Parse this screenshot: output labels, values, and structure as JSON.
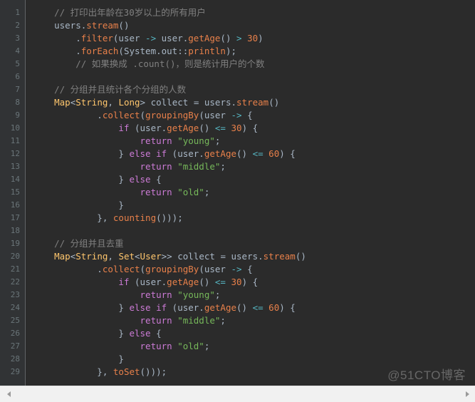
{
  "editor": {
    "theme_name": "darcula",
    "colors": {
      "editor_background": "#2b2b2b",
      "gutter_background": "#313335",
      "gutter_separator": "#606366",
      "line_number": "#6a7579",
      "default_text": "#a9b7c6",
      "comment": "#808080",
      "keyword": "#cc7bd6",
      "type": "#ffc66d",
      "method": "#e8804a",
      "string": "#76b85a",
      "number": "#e8804a",
      "operator": "#56b6c2",
      "chrome_background": "#f1f1f1",
      "scrollbar_thumb": "#cdcdcd"
    },
    "language": "java",
    "total_lines": 29,
    "line_numbers": [
      1,
      2,
      3,
      4,
      5,
      6,
      7,
      8,
      9,
      10,
      11,
      12,
      13,
      14,
      15,
      16,
      17,
      18,
      19,
      20,
      21,
      22,
      23,
      24,
      25,
      26,
      27,
      28,
      29
    ],
    "lines": [
      {
        "number": 1,
        "text": "    // 打印出年龄在30岁以上的所有用户",
        "tokens": [
          {
            "t": "    ",
            "c": "plain"
          },
          {
            "t": "// 打印出年龄在30岁以上的所有用户",
            "c": "comment"
          }
        ]
      },
      {
        "number": 2,
        "text": "    users.stream()",
        "tokens": [
          {
            "t": "    users",
            "c": "plain"
          },
          {
            "t": ".",
            "c": "punc"
          },
          {
            "t": "stream",
            "c": "method"
          },
          {
            "t": "()",
            "c": "punc"
          }
        ]
      },
      {
        "number": 3,
        "text": "        .filter(user -> user.getAge() > 30)",
        "tokens": [
          {
            "t": "        .",
            "c": "punc"
          },
          {
            "t": "filter",
            "c": "method"
          },
          {
            "t": "(user ",
            "c": "plain"
          },
          {
            "t": "->",
            "c": "operator"
          },
          {
            "t": " user.",
            "c": "plain"
          },
          {
            "t": "getAge",
            "c": "method"
          },
          {
            "t": "() ",
            "c": "punc"
          },
          {
            "t": ">",
            "c": "operator"
          },
          {
            "t": " ",
            "c": "plain"
          },
          {
            "t": "30",
            "c": "number"
          },
          {
            "t": ")",
            "c": "punc"
          }
        ]
      },
      {
        "number": 4,
        "text": "        .forEach(System.out::println);",
        "tokens": [
          {
            "t": "        .",
            "c": "punc"
          },
          {
            "t": "forEach",
            "c": "method"
          },
          {
            "t": "(System.out::",
            "c": "plain"
          },
          {
            "t": "println",
            "c": "method"
          },
          {
            "t": ");",
            "c": "punc"
          }
        ]
      },
      {
        "number": 5,
        "text": "        // 如果换成 .count()，则是统计用户的个数",
        "tokens": [
          {
            "t": "        ",
            "c": "plain"
          },
          {
            "t": "// 如果换成 .count()，则是统计用户的个数",
            "c": "comment"
          }
        ]
      },
      {
        "number": 6,
        "text": "",
        "tokens": []
      },
      {
        "number": 7,
        "text": "    // 分组并且统计各个分组的人数",
        "tokens": [
          {
            "t": "    ",
            "c": "plain"
          },
          {
            "t": "// 分组并且统计各个分组的人数",
            "c": "comment"
          }
        ]
      },
      {
        "number": 8,
        "text": "    Map<String, Long> collect = users.stream()",
        "tokens": [
          {
            "t": "    ",
            "c": "plain"
          },
          {
            "t": "Map",
            "c": "type"
          },
          {
            "t": "<",
            "c": "punc"
          },
          {
            "t": "String",
            "c": "type"
          },
          {
            "t": ", ",
            "c": "punc"
          },
          {
            "t": "Long",
            "c": "type"
          },
          {
            "t": "> ",
            "c": "punc"
          },
          {
            "t": "collect = users.",
            "c": "plain"
          },
          {
            "t": "stream",
            "c": "method"
          },
          {
            "t": "()",
            "c": "punc"
          }
        ]
      },
      {
        "number": 9,
        "text": "            .collect(groupingBy(user -> {",
        "tokens": [
          {
            "t": "            .",
            "c": "punc"
          },
          {
            "t": "collect",
            "c": "method"
          },
          {
            "t": "(",
            "c": "punc"
          },
          {
            "t": "groupingBy",
            "c": "method"
          },
          {
            "t": "(user ",
            "c": "plain"
          },
          {
            "t": "->",
            "c": "operator"
          },
          {
            "t": " {",
            "c": "punc"
          }
        ]
      },
      {
        "number": 10,
        "text": "                if (user.getAge() <= 30) {",
        "tokens": [
          {
            "t": "                ",
            "c": "plain"
          },
          {
            "t": "if",
            "c": "keyword"
          },
          {
            "t": " (user.",
            "c": "plain"
          },
          {
            "t": "getAge",
            "c": "method"
          },
          {
            "t": "() ",
            "c": "punc"
          },
          {
            "t": "<=",
            "c": "operator"
          },
          {
            "t": " ",
            "c": "plain"
          },
          {
            "t": "30",
            "c": "number"
          },
          {
            "t": ") {",
            "c": "punc"
          }
        ]
      },
      {
        "number": 11,
        "text": "                    return \"young\";",
        "tokens": [
          {
            "t": "                    ",
            "c": "plain"
          },
          {
            "t": "return",
            "c": "keyword"
          },
          {
            "t": " ",
            "c": "plain"
          },
          {
            "t": "\"young\"",
            "c": "string"
          },
          {
            "t": ";",
            "c": "punc"
          }
        ]
      },
      {
        "number": 12,
        "text": "                } else if (user.getAge() <= 60) {",
        "tokens": [
          {
            "t": "                } ",
            "c": "punc"
          },
          {
            "t": "else if",
            "c": "keyword"
          },
          {
            "t": " (user.",
            "c": "plain"
          },
          {
            "t": "getAge",
            "c": "method"
          },
          {
            "t": "() ",
            "c": "punc"
          },
          {
            "t": "<=",
            "c": "operator"
          },
          {
            "t": " ",
            "c": "plain"
          },
          {
            "t": "60",
            "c": "number"
          },
          {
            "t": ") {",
            "c": "punc"
          }
        ]
      },
      {
        "number": 13,
        "text": "                    return \"middle\";",
        "tokens": [
          {
            "t": "                    ",
            "c": "plain"
          },
          {
            "t": "return",
            "c": "keyword"
          },
          {
            "t": " ",
            "c": "plain"
          },
          {
            "t": "\"middle\"",
            "c": "string"
          },
          {
            "t": ";",
            "c": "punc"
          }
        ]
      },
      {
        "number": 14,
        "text": "                } else {",
        "tokens": [
          {
            "t": "                } ",
            "c": "punc"
          },
          {
            "t": "else",
            "c": "keyword"
          },
          {
            "t": " {",
            "c": "punc"
          }
        ]
      },
      {
        "number": 15,
        "text": "                    return \"old\";",
        "tokens": [
          {
            "t": "                    ",
            "c": "plain"
          },
          {
            "t": "return",
            "c": "keyword"
          },
          {
            "t": " ",
            "c": "plain"
          },
          {
            "t": "\"old\"",
            "c": "string"
          },
          {
            "t": ";",
            "c": "punc"
          }
        ]
      },
      {
        "number": 16,
        "text": "                }",
        "tokens": [
          {
            "t": "                }",
            "c": "punc"
          }
        ]
      },
      {
        "number": 17,
        "text": "            }, counting()));",
        "tokens": [
          {
            "t": "            }, ",
            "c": "punc"
          },
          {
            "t": "counting",
            "c": "method"
          },
          {
            "t": "()));",
            "c": "punc"
          }
        ]
      },
      {
        "number": 18,
        "text": "",
        "tokens": []
      },
      {
        "number": 19,
        "text": "    // 分组并且去重",
        "tokens": [
          {
            "t": "    ",
            "c": "plain"
          },
          {
            "t": "// 分组并且去重",
            "c": "comment"
          }
        ]
      },
      {
        "number": 20,
        "text": "    Map<String, Set<User>> collect = users.stream()",
        "tokens": [
          {
            "t": "    ",
            "c": "plain"
          },
          {
            "t": "Map",
            "c": "type"
          },
          {
            "t": "<",
            "c": "punc"
          },
          {
            "t": "String",
            "c": "type"
          },
          {
            "t": ", ",
            "c": "punc"
          },
          {
            "t": "Set",
            "c": "type"
          },
          {
            "t": "<",
            "c": "punc"
          },
          {
            "t": "User",
            "c": "type"
          },
          {
            "t": ">> ",
            "c": "punc"
          },
          {
            "t": "collect = users.",
            "c": "plain"
          },
          {
            "t": "stream",
            "c": "method"
          },
          {
            "t": "()",
            "c": "punc"
          }
        ]
      },
      {
        "number": 21,
        "text": "            .collect(groupingBy(user -> {",
        "tokens": [
          {
            "t": "            .",
            "c": "punc"
          },
          {
            "t": "collect",
            "c": "method"
          },
          {
            "t": "(",
            "c": "punc"
          },
          {
            "t": "groupingBy",
            "c": "method"
          },
          {
            "t": "(user ",
            "c": "plain"
          },
          {
            "t": "->",
            "c": "operator"
          },
          {
            "t": " {",
            "c": "punc"
          }
        ]
      },
      {
        "number": 22,
        "text": "                if (user.getAge() <= 30) {",
        "tokens": [
          {
            "t": "                ",
            "c": "plain"
          },
          {
            "t": "if",
            "c": "keyword"
          },
          {
            "t": " (user.",
            "c": "plain"
          },
          {
            "t": "getAge",
            "c": "method"
          },
          {
            "t": "() ",
            "c": "punc"
          },
          {
            "t": "<=",
            "c": "operator"
          },
          {
            "t": " ",
            "c": "plain"
          },
          {
            "t": "30",
            "c": "number"
          },
          {
            "t": ") {",
            "c": "punc"
          }
        ]
      },
      {
        "number": 23,
        "text": "                    return \"young\";",
        "tokens": [
          {
            "t": "                    ",
            "c": "plain"
          },
          {
            "t": "return",
            "c": "keyword"
          },
          {
            "t": " ",
            "c": "plain"
          },
          {
            "t": "\"young\"",
            "c": "string"
          },
          {
            "t": ";",
            "c": "punc"
          }
        ]
      },
      {
        "number": 24,
        "text": "                } else if (user.getAge() <= 60) {",
        "tokens": [
          {
            "t": "                } ",
            "c": "punc"
          },
          {
            "t": "else if",
            "c": "keyword"
          },
          {
            "t": " (user.",
            "c": "plain"
          },
          {
            "t": "getAge",
            "c": "method"
          },
          {
            "t": "() ",
            "c": "punc"
          },
          {
            "t": "<=",
            "c": "operator"
          },
          {
            "t": " ",
            "c": "plain"
          },
          {
            "t": "60",
            "c": "number"
          },
          {
            "t": ") {",
            "c": "punc"
          }
        ]
      },
      {
        "number": 25,
        "text": "                    return \"middle\";",
        "tokens": [
          {
            "t": "                    ",
            "c": "plain"
          },
          {
            "t": "return",
            "c": "keyword"
          },
          {
            "t": " ",
            "c": "plain"
          },
          {
            "t": "\"middle\"",
            "c": "string"
          },
          {
            "t": ";",
            "c": "punc"
          }
        ]
      },
      {
        "number": 26,
        "text": "                } else {",
        "tokens": [
          {
            "t": "                } ",
            "c": "punc"
          },
          {
            "t": "else",
            "c": "keyword"
          },
          {
            "t": " {",
            "c": "punc"
          }
        ]
      },
      {
        "number": 27,
        "text": "                    return \"old\";",
        "tokens": [
          {
            "t": "                    ",
            "c": "plain"
          },
          {
            "t": "return",
            "c": "keyword"
          },
          {
            "t": " ",
            "c": "plain"
          },
          {
            "t": "\"old\"",
            "c": "string"
          },
          {
            "t": ";",
            "c": "punc"
          }
        ]
      },
      {
        "number": 28,
        "text": "                }",
        "tokens": [
          {
            "t": "                }",
            "c": "punc"
          }
        ]
      },
      {
        "number": 29,
        "text": "            }, toSet()));",
        "tokens": [
          {
            "t": "            }, ",
            "c": "punc"
          },
          {
            "t": "toSet",
            "c": "method"
          },
          {
            "t": "()));",
            "c": "punc"
          }
        ]
      }
    ]
  },
  "watermark": {
    "text": "@51CTO博客"
  },
  "scrollbar": {
    "orientation": "horizontal",
    "left_arrow_icon": "triangle-left-icon",
    "right_arrow_icon": "triangle-right-icon",
    "thumb_visible": false
  }
}
